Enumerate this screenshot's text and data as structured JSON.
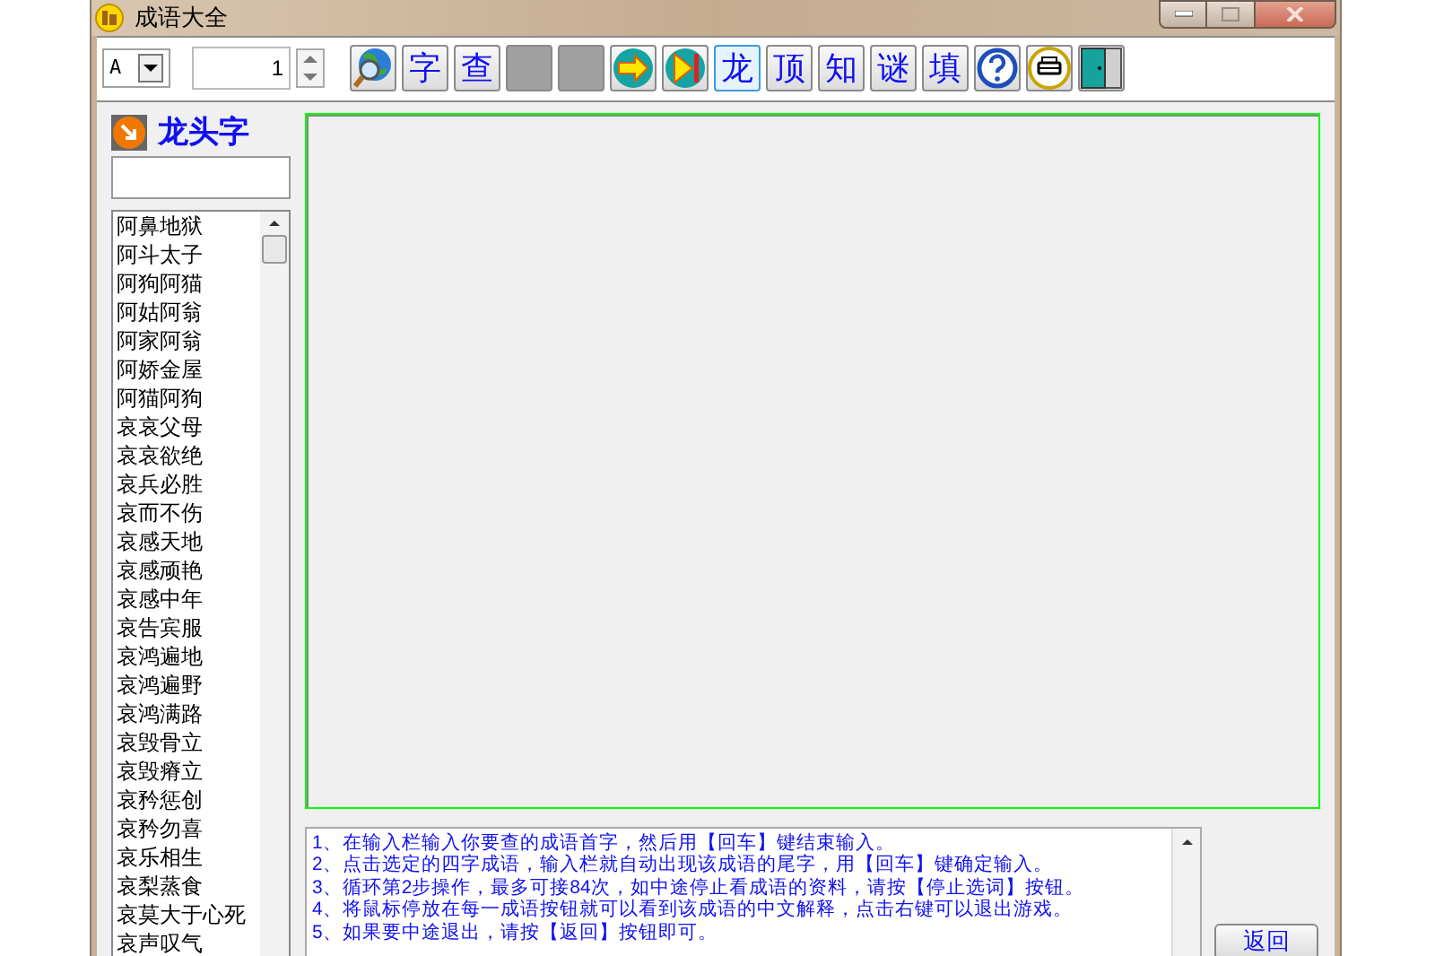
{
  "window": {
    "title": "成语大全"
  },
  "toolbar": {
    "font_select": {
      "value": "A"
    },
    "spinner": {
      "value": "1"
    },
    "buttons": [
      {
        "kind": "globe",
        "selected": false
      },
      {
        "kind": "text",
        "label": "字",
        "selected": false
      },
      {
        "kind": "text",
        "label": "查",
        "selected": false
      },
      {
        "kind": "blank",
        "selected": false
      },
      {
        "kind": "blank",
        "selected": false
      },
      {
        "kind": "arrow",
        "selected": false
      },
      {
        "kind": "skip",
        "selected": false
      },
      {
        "kind": "text",
        "label": "龙",
        "selected": true
      },
      {
        "kind": "text",
        "label": "顶",
        "selected": false
      },
      {
        "kind": "text",
        "label": "知",
        "selected": false
      },
      {
        "kind": "text",
        "label": "谜",
        "selected": false
      },
      {
        "kind": "text",
        "label": "填",
        "selected": false
      },
      {
        "kind": "help",
        "selected": false
      },
      {
        "kind": "printer",
        "selected": false
      },
      {
        "kind": "door",
        "selected": false
      }
    ]
  },
  "sidebar": {
    "title": "龙头字",
    "items": [
      "阿鼻地狱",
      "阿斗太子",
      "阿狗阿猫",
      "阿姑阿翁",
      "阿家阿翁",
      "阿娇金屋",
      "阿猫阿狗",
      "哀哀父母",
      "哀哀欲绝",
      "哀兵必胜",
      "哀而不伤",
      "哀感天地",
      "哀感顽艳",
      "哀感中年",
      "哀告宾服",
      "哀鸿遍地",
      "哀鸿遍野",
      "哀鸿满路",
      "哀毁骨立",
      "哀毁瘠立",
      "哀矜惩创",
      "哀矜勿喜",
      "哀乐相生",
      "哀梨蒸食",
      "哀莫大于心死",
      "哀声叹气"
    ]
  },
  "instructions": [
    "1、在输入栏输入你要查的成语首字，然后用【回车】键结束输入。",
    "2、点击选定的四字成语，输入栏就自动出现该成语的尾字，用【回车】键确定输入。",
    "3、循环第2步操作，最多可接84次，如中途停止看成语的资料，请按【停止选词】按钮。",
    "4、将鼠标停放在每一成语按钮就可以看到该成语的中文解释，点击右键可以退出游戏。",
    "5、如果要中途退出，请按【返回】按钮即可。"
  ],
  "back_button": "返回"
}
